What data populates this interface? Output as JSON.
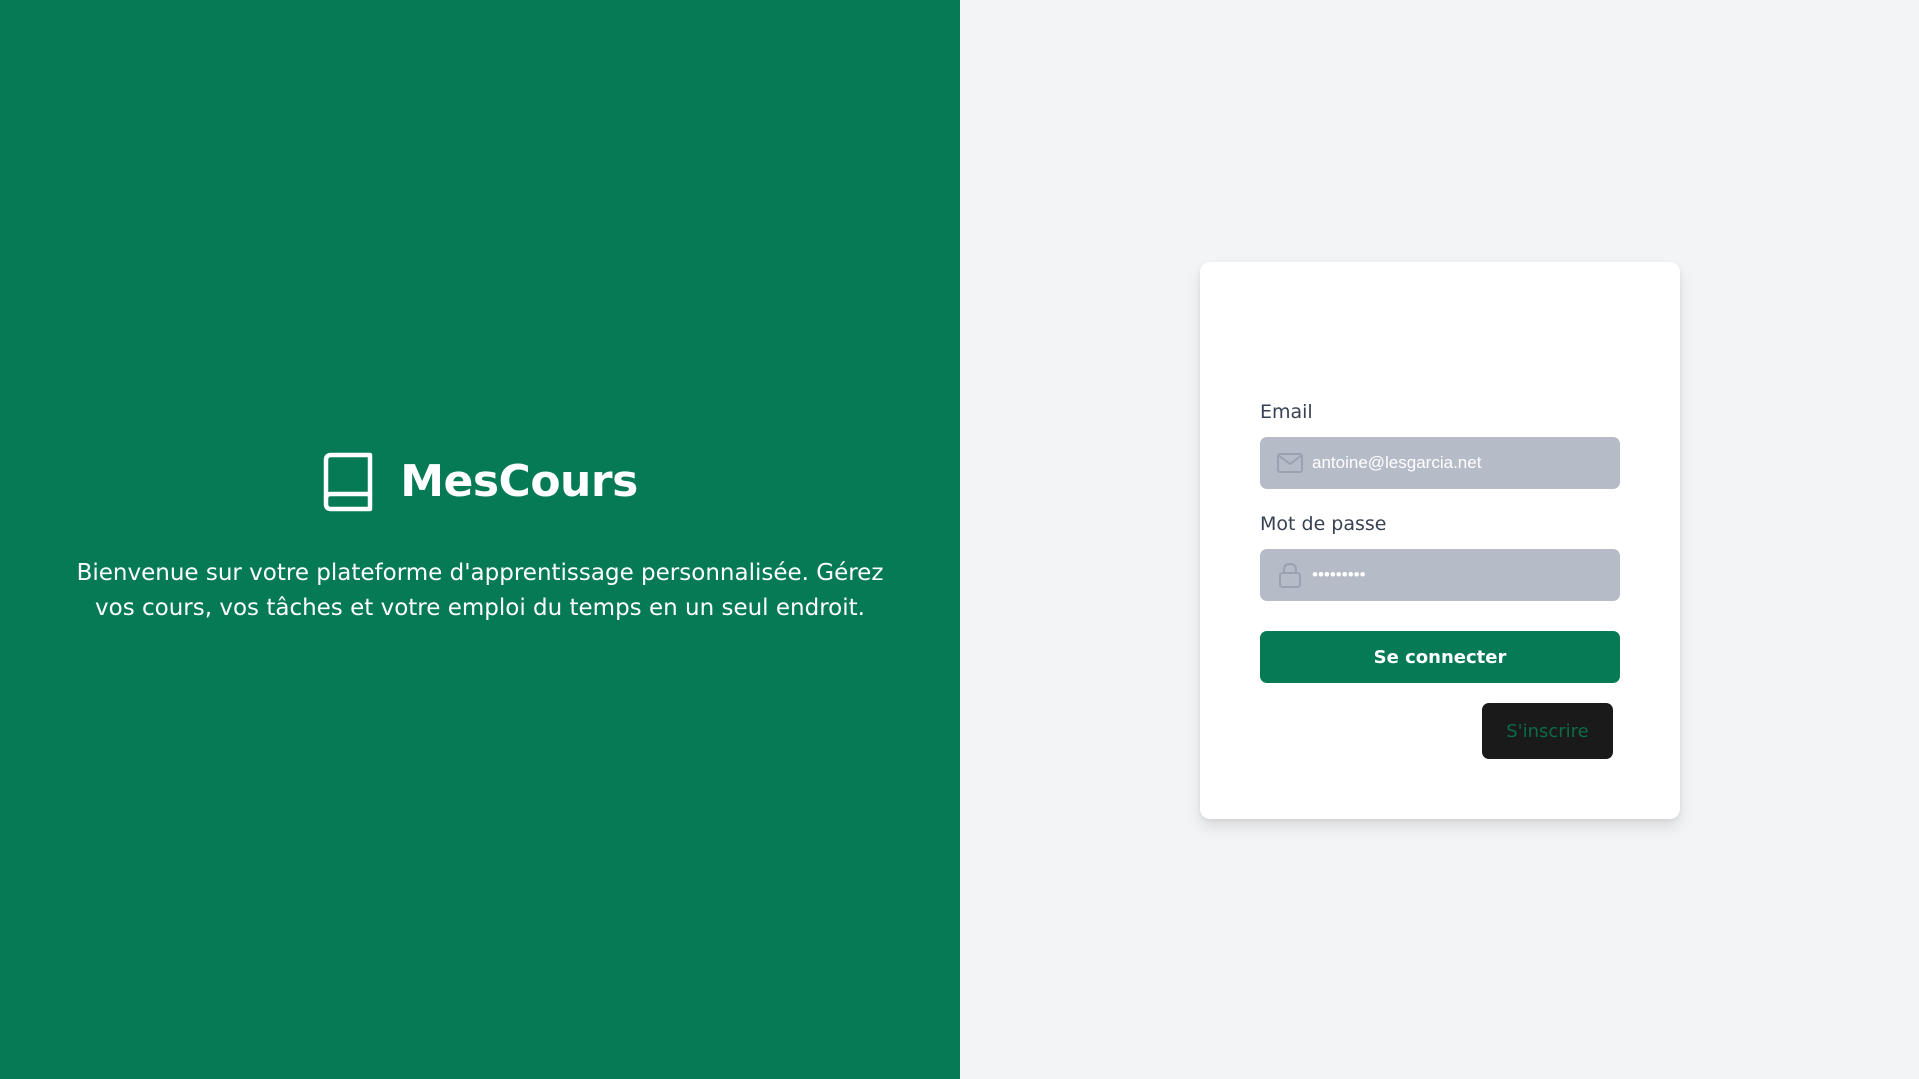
{
  "brand": {
    "icon": "book-icon",
    "name": "MesCours",
    "tagline": "Bienvenue sur votre plateforme d'apprentissage personnalisée. Gérez vos cours, vos tâches et votre emploi du temps en un seul endroit."
  },
  "login_form": {
    "email_label": "Email",
    "email_icon": "envelope-icon",
    "email_value": "antoine@lesgarcia.net",
    "password_label": "Mot de passe",
    "password_icon": "lock-icon",
    "password_value": "•••••••••",
    "submit_label": "Se connecter",
    "signup_label": "S'inscrire"
  },
  "colors": {
    "brand_green": "#057a55",
    "input_bg": "#b6bbc8",
    "page_bg": "#f3f4f6",
    "signup_bg": "#1a1a1a"
  }
}
